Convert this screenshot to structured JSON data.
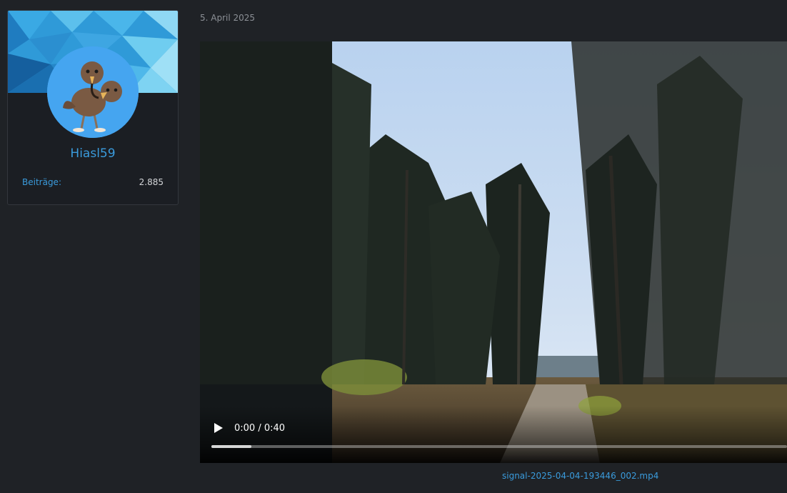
{
  "user": {
    "username": "Hiasl59",
    "stats": [
      {
        "label": "Beiträge:",
        "value": "2.885"
      }
    ]
  },
  "post": {
    "date": "5. April 2025",
    "video": {
      "time": "0:00 / 0:40",
      "buffered_fraction": 0.07
    },
    "attachment": {
      "filename": "signal-2025-04-04-193446_002.mp4"
    }
  },
  "colors": {
    "background": "#1f2226",
    "card": "#1b1e23",
    "link": "#3a9bdc",
    "muted": "#8c9096",
    "avatar_bg": "#45a5f0"
  },
  "icons": {
    "play": "play-icon"
  }
}
